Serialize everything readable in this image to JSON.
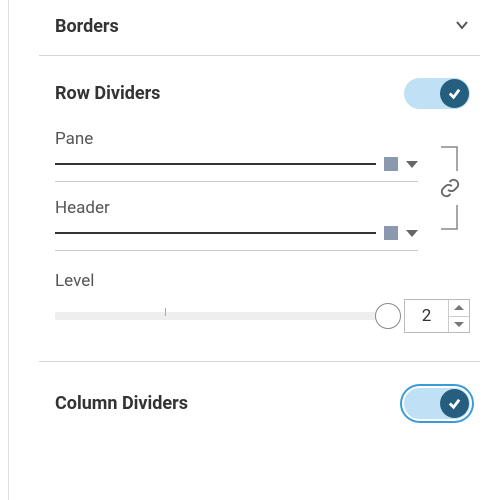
{
  "sections": {
    "borders": {
      "title": "Borders"
    }
  },
  "rowDividers": {
    "title": "Row Dividers",
    "enabled": true,
    "pane": {
      "label": "Pane",
      "color": "#8a99ad"
    },
    "header": {
      "label": "Header",
      "color": "#8a99ad"
    },
    "linked": true,
    "level": {
      "label": "Level",
      "value": "2"
    }
  },
  "columnDividers": {
    "title": "Column Dividers",
    "enabled": true,
    "focused": true
  }
}
